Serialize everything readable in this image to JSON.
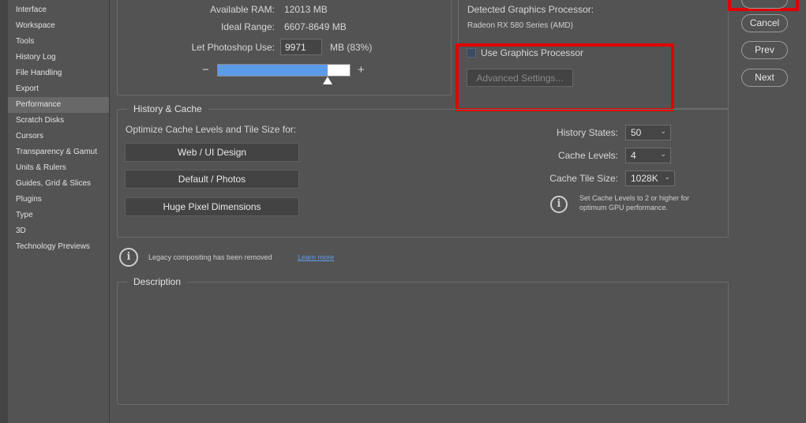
{
  "sidebar": {
    "items": [
      {
        "label": "Interface"
      },
      {
        "label": "Workspace"
      },
      {
        "label": "Tools"
      },
      {
        "label": "History Log"
      },
      {
        "label": "File Handling"
      },
      {
        "label": "Export"
      },
      {
        "label": "Performance"
      },
      {
        "label": "Scratch Disks"
      },
      {
        "label": "Cursors"
      },
      {
        "label": "Transparency & Gamut"
      },
      {
        "label": "Units & Rulers"
      },
      {
        "label": "Guides, Grid & Slices"
      },
      {
        "label": "Plugins"
      },
      {
        "label": "Type"
      },
      {
        "label": "3D"
      },
      {
        "label": "Technology Previews"
      }
    ],
    "active": "Performance"
  },
  "memory": {
    "available_ram_label": "Available RAM:",
    "available_ram_value": "12013 MB",
    "ideal_range_label": "Ideal Range:",
    "ideal_range_value": "6607-8649 MB",
    "let_use_label": "Let Photoshop Use:",
    "let_use_value": "9971",
    "let_use_unit": "MB (83%)",
    "minus": "−",
    "plus": "+",
    "slider_fraction": 0.83
  },
  "gpu": {
    "detected_label": "Detected Graphics Processor:",
    "detected_value": "Radeon RX 580 Series (AMD)",
    "use_gpu_label": "Use Graphics Processor",
    "advanced_label": "Advanced Settings..."
  },
  "buttons": {
    "cancel": "Cancel",
    "prev": "Prev",
    "next": "Next"
  },
  "history_cache": {
    "title": "History & Cache",
    "optimize_label": "Optimize Cache Levels and Tile Size for:",
    "preset_web": "Web / UI Design",
    "preset_default": "Default / Photos",
    "preset_huge": "Huge Pixel Dimensions",
    "history_states_label": "History States:",
    "history_states_value": "50",
    "cache_levels_label": "Cache Levels:",
    "cache_levels_value": "4",
    "cache_tile_label": "Cache Tile Size:",
    "cache_tile_value": "1028K",
    "hint_line1": "Set Cache Levels to 2 or higher for",
    "hint_line2": "optimum GPU performance."
  },
  "legacy": {
    "text": "Legacy compositing has been removed",
    "link": "Learn more"
  },
  "description": {
    "title": "Description"
  },
  "colors": {
    "accent_slider": "#5b9bea",
    "highlight_red": "#e00000",
    "link_blue": "#5e9ee8"
  }
}
